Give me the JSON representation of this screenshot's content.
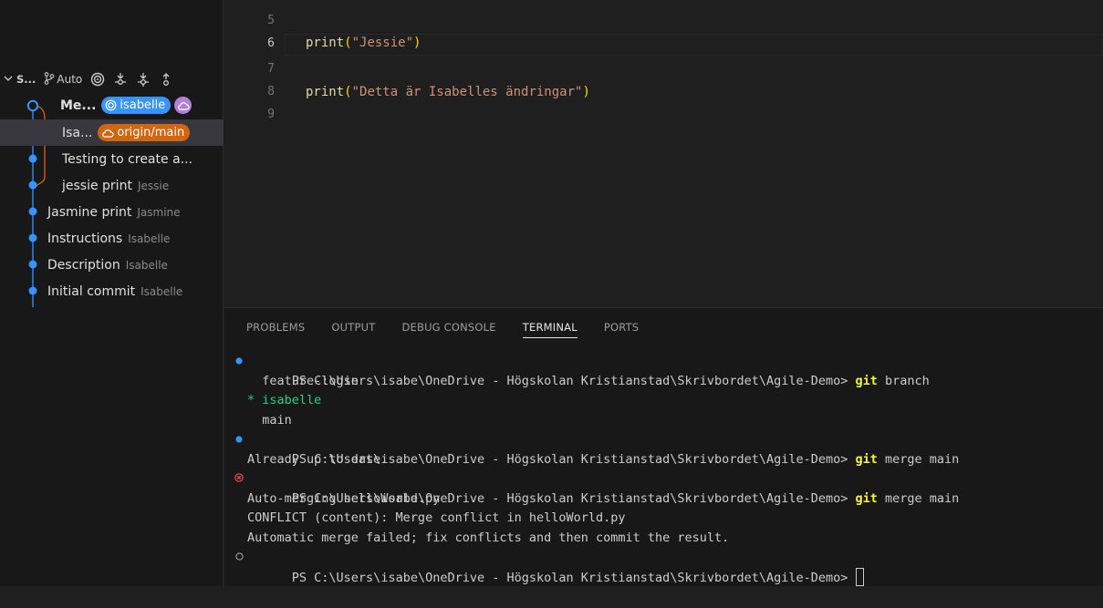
{
  "source_control": {
    "title": "S...",
    "branch_mode": "Auto",
    "commits": [
      {
        "message": "Me...",
        "author": "",
        "badges": [
          {
            "label": "isabelle",
            "kind": "local-branch"
          },
          {
            "label": "",
            "kind": "remote-icon"
          }
        ]
      },
      {
        "message": "Isa...",
        "author": "",
        "badges": [
          {
            "label": "origin/main",
            "kind": "remote-branch"
          }
        ]
      },
      {
        "message": "Testing to create a...",
        "author": ""
      },
      {
        "message": "jessie print",
        "author": "Jessie"
      },
      {
        "message": "Jasmine print",
        "author": "Jasmine"
      },
      {
        "message": "Instructions",
        "author": "Isabelle"
      },
      {
        "message": "Description",
        "author": "Isabelle"
      },
      {
        "message": "Initial commit",
        "author": "Isabelle"
      }
    ]
  },
  "editor": {
    "lines": [
      {
        "n": "5",
        "text": ""
      },
      {
        "n": "6",
        "fn": "print",
        "str": "\"Jessie\""
      },
      {
        "n": "7",
        "text": ""
      },
      {
        "n": "8",
        "fn": "print",
        "str": "\"Detta är Isabelles ändringar\""
      },
      {
        "n": "9",
        "text": ""
      }
    ]
  },
  "panel": {
    "tabs": [
      "PROBLEMS",
      "OUTPUT",
      "DEBUG CONSOLE",
      "TERMINAL",
      "PORTS"
    ],
    "active_tab": "TERMINAL",
    "terminal": {
      "prompt": "PS C:\\Users\\isabe\\OneDrive - Högskolan Kristianstad\\Skrivbordet\\Agile-Demo> ",
      "git": "git",
      "cmd_branch": " branch",
      "branch_1": "  feature-login",
      "branch_current": "* isabelle",
      "branch_3": "  main",
      "cmd_merge": " merge main",
      "out_uptodate": "Already up to date.",
      "out_automerge": "Auto-merging helloWorld.py",
      "out_conflict": "CONFLICT (content): Merge conflict in helloWorld.py",
      "out_failed": "Automatic merge failed; fix conflicts and then commit the result."
    }
  },
  "colors": {
    "accent_blue": "#3794ff",
    "accent_orange": "#d26512",
    "git_keyword": "#f5f543",
    "current_branch": "#23d18b",
    "error_mark": "#f14c4c"
  }
}
